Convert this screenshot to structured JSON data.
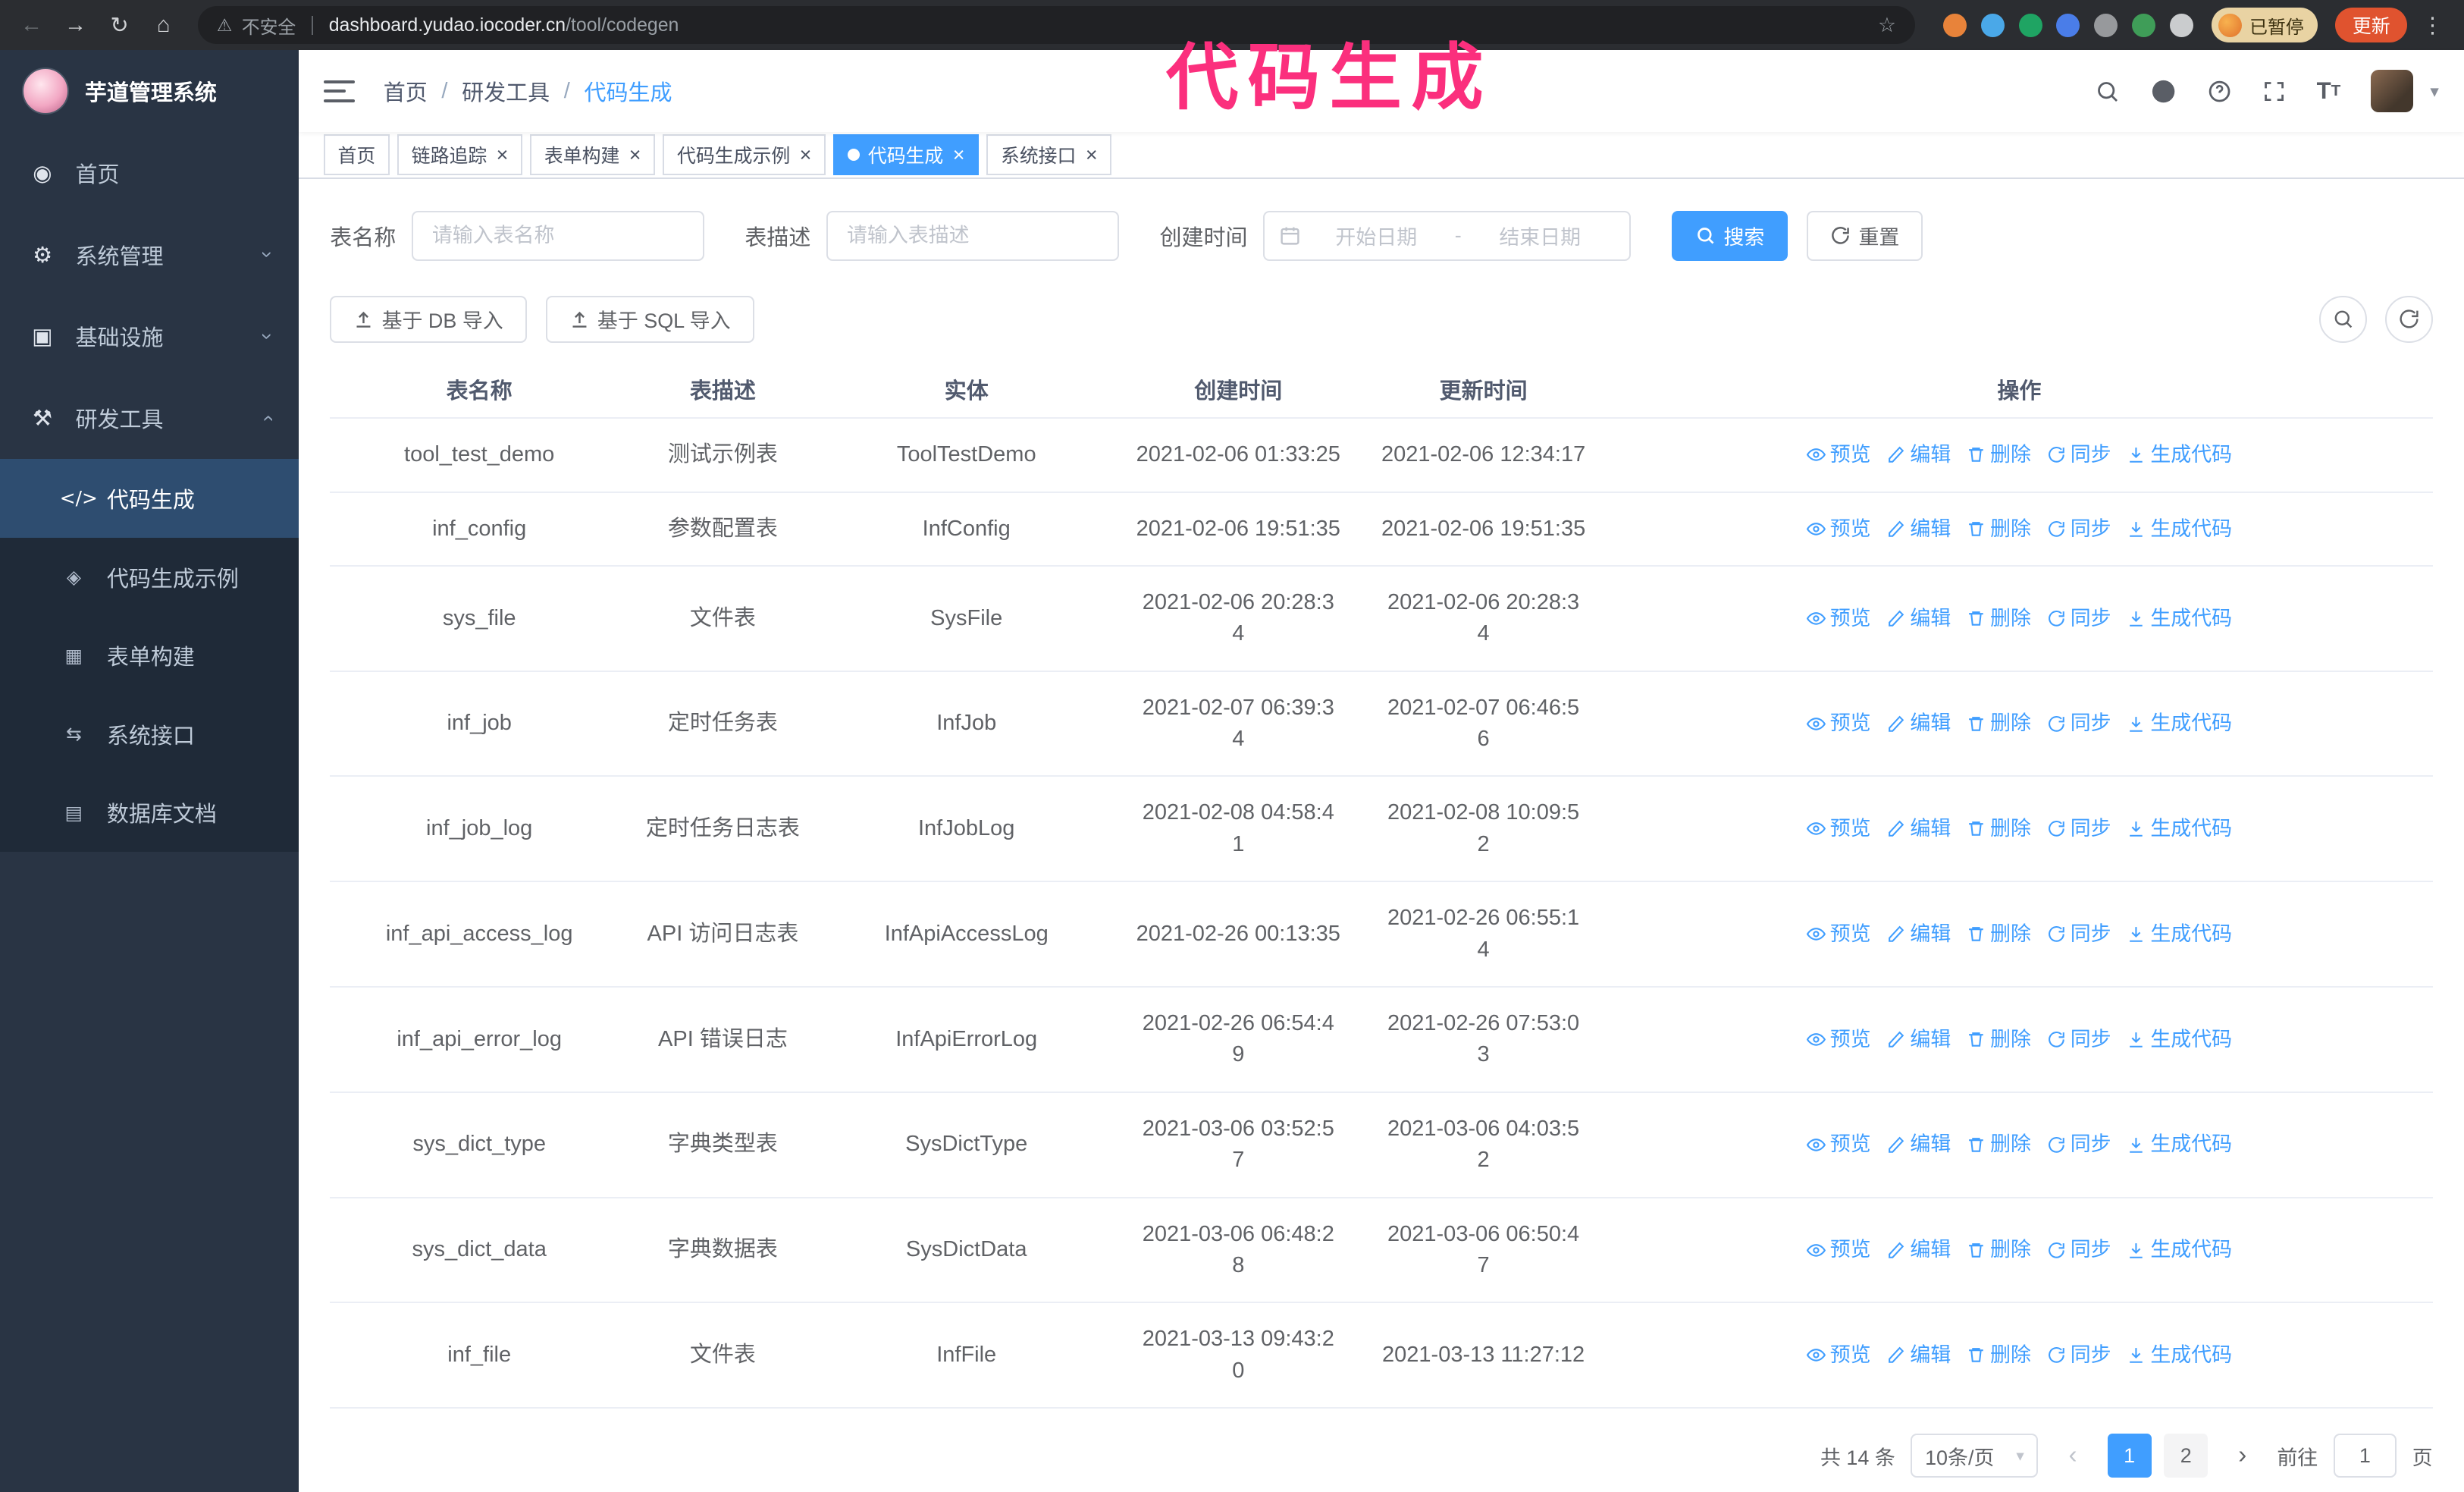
{
  "annotation": {
    "text": "代码生成",
    "color": "#fb2f7d"
  },
  "browser": {
    "security_label": "不安全",
    "url_domain": "dashboard.yudao.iocoder.cn",
    "url_path": "/tool/codegen",
    "paused_badge": "已暂停",
    "update_button": "更新",
    "extensions": [
      {
        "color": "#e8833a"
      },
      {
        "color": "#4aa8e8"
      },
      {
        "color": "#1fa463"
      },
      {
        "color": "#4a7de8"
      },
      {
        "color": "#97999c"
      },
      {
        "color": "#3f9d58"
      },
      {
        "color": "#caccce"
      }
    ]
  },
  "sidebar": {
    "logo_title": "芋道管理系统",
    "items": [
      {
        "id": "home",
        "label": "首页",
        "icon": "dashboard-icon",
        "glyph": "◉",
        "level": 1
      },
      {
        "id": "system",
        "label": "系统管理",
        "icon": "gear-icon",
        "glyph": "⚙",
        "level": 1,
        "arrow": "down"
      },
      {
        "id": "infra",
        "label": "基础设施",
        "icon": "infrastructure-icon",
        "glyph": "▣",
        "level": 1,
        "arrow": "down"
      },
      {
        "id": "devtools",
        "label": "研发工具",
        "icon": "tools-icon",
        "glyph": "⚒",
        "level": 1,
        "arrow": "up",
        "expanded": true
      },
      {
        "id": "codegen",
        "label": "代码生成",
        "icon": "code-icon",
        "glyph": "</>",
        "level": 2,
        "active": true
      },
      {
        "id": "codegen-example",
        "label": "代码生成示例",
        "icon": "badge-icon",
        "glyph": "◈",
        "level": 2
      },
      {
        "id": "form-builder",
        "label": "表单构建",
        "icon": "form-icon",
        "glyph": "▦",
        "level": 2
      },
      {
        "id": "api",
        "label": "系统接口",
        "icon": "api-icon",
        "glyph": "⇆",
        "level": 2
      },
      {
        "id": "db-doc",
        "label": "数据库文档",
        "icon": "database-doc-icon",
        "glyph": "▤",
        "level": 2
      }
    ]
  },
  "header": {
    "breadcrumbs": [
      "首页",
      "研发工具",
      "代码生成"
    ],
    "separator": "/"
  },
  "tabs": [
    {
      "id": "home",
      "label": "首页",
      "closable": false
    },
    {
      "id": "trace",
      "label": "链路追踪",
      "closable": true
    },
    {
      "id": "form-builder",
      "label": "表单构建",
      "closable": true
    },
    {
      "id": "codegen-example",
      "label": "代码生成示例",
      "closable": true
    },
    {
      "id": "codegen",
      "label": "代码生成",
      "closable": true,
      "active": true
    },
    {
      "id": "api",
      "label": "系统接口",
      "closable": true
    }
  ],
  "filters": {
    "table_name_label": "表名称",
    "table_name_placeholder": "请输入表名称",
    "table_desc_label": "表描述",
    "table_desc_placeholder": "请输入表描述",
    "create_time_label": "创建时间",
    "date_start_placeholder": "开始日期",
    "date_separator": "-",
    "date_end_placeholder": "结束日期",
    "search_button": "搜索",
    "reset_button": "重置"
  },
  "toolbar": {
    "import_db_button": "基于 DB 导入",
    "import_sql_button": "基于 SQL 导入"
  },
  "table": {
    "columns": [
      "表名称",
      "表描述",
      "实体",
      "创建时间",
      "更新时间",
      "操作"
    ],
    "actions": {
      "preview": "预览",
      "edit": "编辑",
      "delete": "删除",
      "sync": "同步",
      "generate": "生成代码"
    },
    "rows": [
      {
        "name": "tool_test_demo",
        "desc": "测试示例表",
        "entity": "ToolTestDemo",
        "create_time": "2021-02-06 01:33:25",
        "update_time": "2021-02-06 12:34:17"
      },
      {
        "name": "inf_config",
        "desc": "参数配置表",
        "entity": "InfConfig",
        "create_time": "2021-02-06 19:51:35",
        "update_time": "2021-02-06 19:51:35"
      },
      {
        "name": "sys_file",
        "desc": "文件表",
        "entity": "SysFile",
        "create_time": "2021-02-06 20:28:3\n4",
        "update_time": "2021-02-06 20:28:3\n4"
      },
      {
        "name": "inf_job",
        "desc": "定时任务表",
        "entity": "InfJob",
        "create_time": "2021-02-07 06:39:3\n4",
        "update_time": "2021-02-07 06:46:5\n6"
      },
      {
        "name": "inf_job_log",
        "desc": "定时任务日志表",
        "entity": "InfJobLog",
        "create_time": "2021-02-08 04:58:4\n1",
        "update_time": "2021-02-08 10:09:5\n2"
      },
      {
        "name": "inf_api_access_log",
        "desc": "API 访问日志表",
        "entity": "InfApiAccessLog",
        "create_time": "2021-02-26 00:13:35",
        "update_time": "2021-02-26 06:55:1\n4"
      },
      {
        "name": "inf_api_error_log",
        "desc": "API 错误日志",
        "entity": "InfApiErrorLog",
        "create_time": "2021-02-26 06:54:4\n9",
        "update_time": "2021-02-26 07:53:0\n3"
      },
      {
        "name": "sys_dict_type",
        "desc": "字典类型表",
        "entity": "SysDictType",
        "create_time": "2021-03-06 03:52:5\n7",
        "update_time": "2021-03-06 04:03:5\n2"
      },
      {
        "name": "sys_dict_data",
        "desc": "字典数据表",
        "entity": "SysDictData",
        "create_time": "2021-03-06 06:48:2\n8",
        "update_time": "2021-03-06 06:50:4\n7"
      },
      {
        "name": "inf_file",
        "desc": "文件表",
        "entity": "InfFile",
        "create_time": "2021-03-13 09:43:2\n0",
        "update_time": "2021-03-13 11:27:12"
      }
    ]
  },
  "pagination": {
    "total_text": "共 14 条",
    "page_size": "10条/页",
    "pages": [
      "1",
      "2"
    ],
    "active_page": "1",
    "goto_label": "前往",
    "goto_value": "1",
    "goto_suffix": "页"
  }
}
